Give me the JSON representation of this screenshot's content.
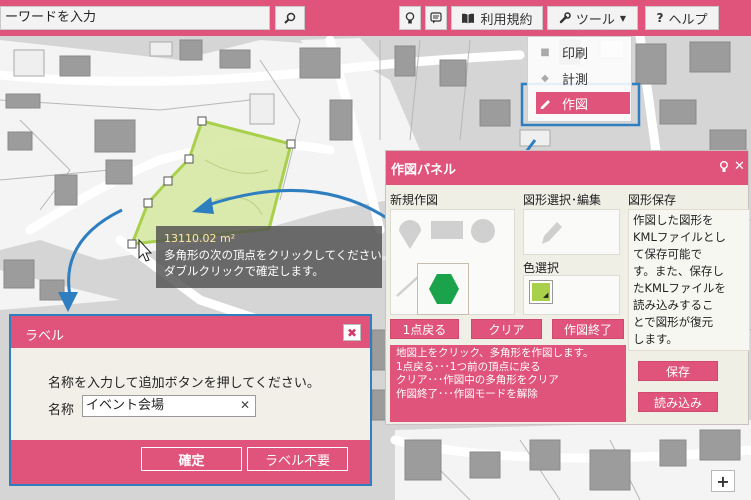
{
  "search": {
    "value": "ーワードを入力"
  },
  "toolbar": {
    "terms_label": "利用規約",
    "tools_label": "ツール",
    "help_label": "ヘルプ"
  },
  "tools_menu": {
    "items": [
      {
        "label": "印刷",
        "icon": "print-icon"
      },
      {
        "label": "計測",
        "icon": "measure-icon"
      },
      {
        "label": "作図",
        "icon": "pencil-icon"
      }
    ]
  },
  "draw_panel": {
    "title": "作図パネル",
    "new_drawing": "新規作図",
    "shape_select": "図形選択･編集",
    "save_shape": "図形保存",
    "color_select": "色選択",
    "undo_label": "1点戻る",
    "clear_label": "クリア",
    "finish_label": "作図終了",
    "info_lines": [
      "地図上をクリック、多角形を作図します。",
      "1点戻る･･･1つ前の頂点に戻る",
      "クリア･･･作図中の多角形をクリア",
      "作図終了･･･作図モードを解除"
    ],
    "store_lines": [
      "作図した図形を",
      "KMLファイルとし",
      "て保存可能で",
      "す。また、保存し",
      "たKMLファイルを",
      "読み込みするこ",
      "とで図形が復元",
      "します。"
    ],
    "save_label": "保存",
    "load_label": "読み込み",
    "selected_color": "#a8d04a"
  },
  "tooltip": {
    "area": "13110.02 m²",
    "line1": "多角形の次の頂点をクリックしてください。",
    "line2": "ダブルクリックで確定します。"
  },
  "label_dialog": {
    "title": "ラベル",
    "message": "名称を入力して追加ボタンを押してください。",
    "name_label": "名称",
    "name_value": "イベント会場",
    "confirm_label": "確定",
    "no_label_label": "ラベル不要"
  },
  "colors": {
    "accent": "#e0537b",
    "callout_blue": "#2f7fc0",
    "polygon_fill": "#d5e89f",
    "polygon_stroke": "#a8d04a",
    "hexagon": "#1aa34a"
  },
  "zoom": {
    "in_label": "+"
  }
}
